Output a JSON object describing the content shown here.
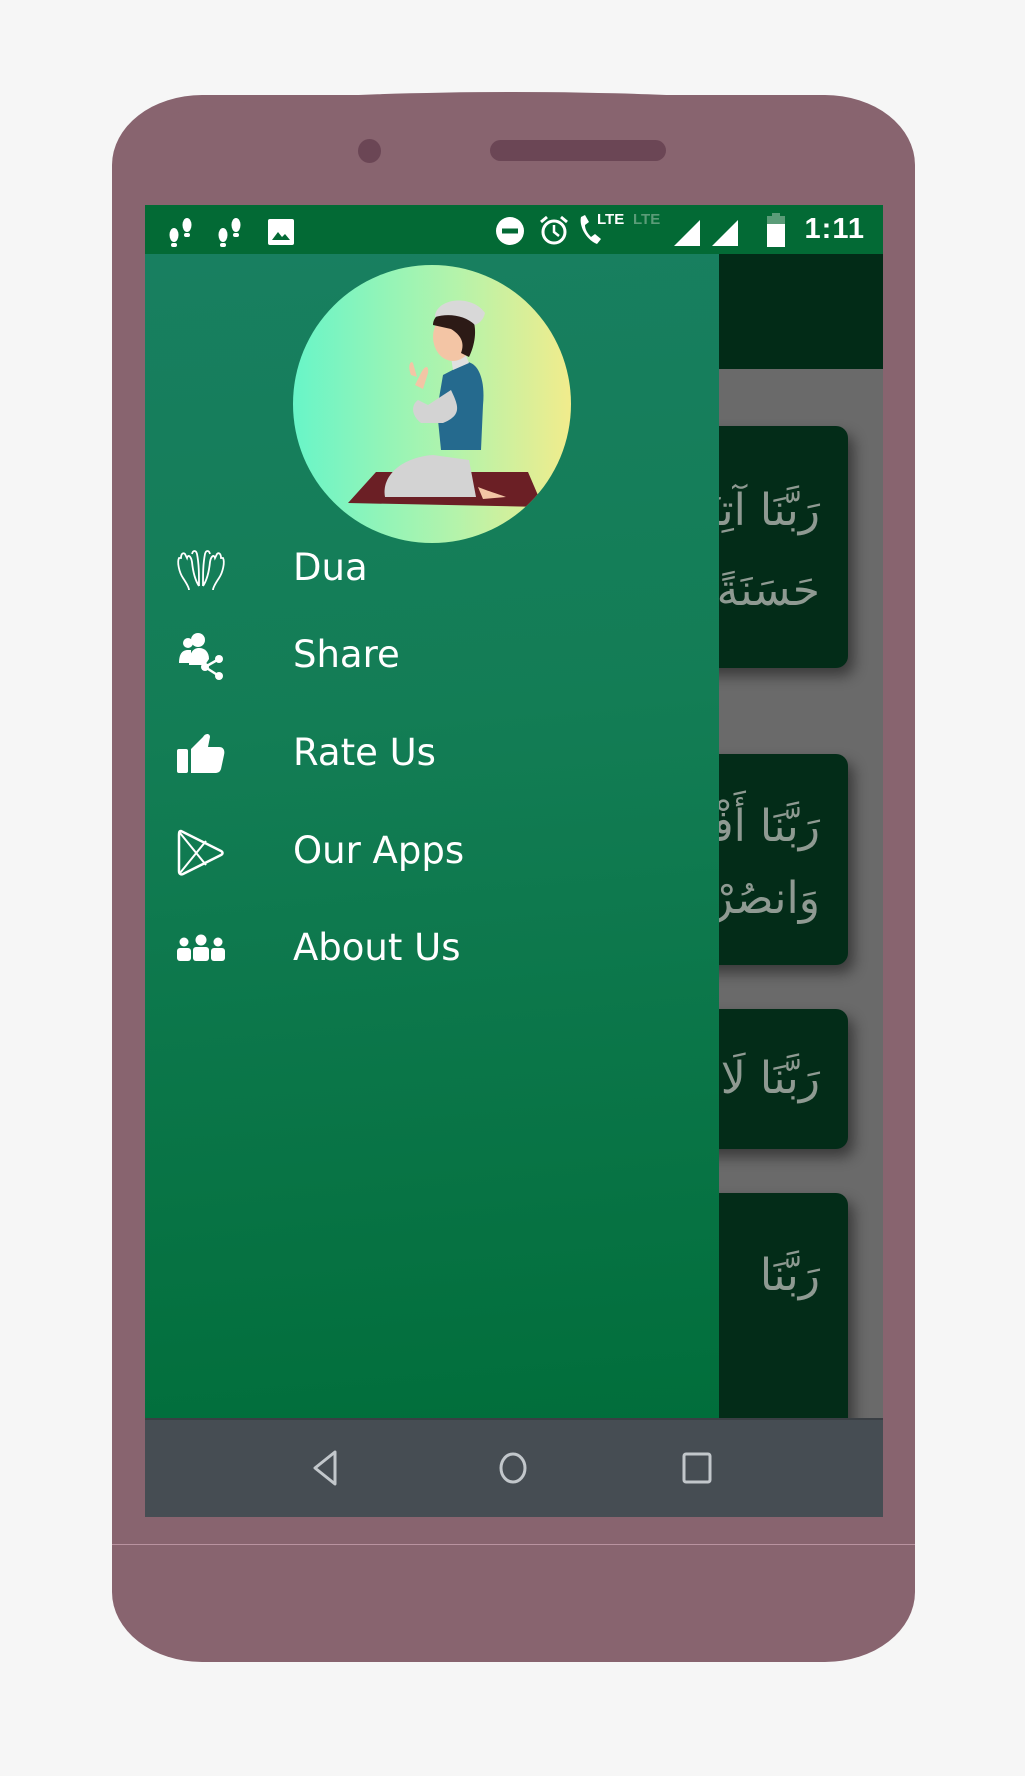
{
  "status_bar": {
    "left_icons": [
      "footsteps-icon",
      "footsteps-icon",
      "image-icon"
    ],
    "right_icons": [
      "do-not-disturb-icon",
      "alarm-icon",
      "lte-call-icon",
      "lte-disabled-icon",
      "signal-icon",
      "signal-icon",
      "battery-icon"
    ],
    "lte_label": "LTE",
    "lte_disabled_label": "LTE",
    "time": "1:11"
  },
  "drawer": {
    "header_image": "boy-praying-on-mat",
    "items": [
      {
        "label": "Dua",
        "icon": "praying-hands-icon"
      },
      {
        "label": "Share",
        "icon": "share-users-icon"
      },
      {
        "label": "Rate Us",
        "icon": "thumbs-up-icon"
      },
      {
        "label": "Our Apps",
        "icon": "play-store-icon"
      },
      {
        "label": "About Us",
        "icon": "group-icon"
      }
    ]
  },
  "background_cards": [
    {
      "lines": [
        "رَبَّنَا آتِنَا",
        "حَسَنَةً"
      ]
    },
    {
      "lines": [
        "رَبَّنَا أَفْرِغْ",
        "وَانصُرْنَا"
      ]
    },
    {
      "lines": [
        "رَبَّنَا لَا"
      ]
    },
    {
      "lines": [
        "رَبَّنَا"
      ]
    }
  ],
  "nav_bar": {
    "back": "back-icon",
    "home": "home-icon",
    "recents": "recents-icon"
  },
  "colors": {
    "status_bar": "#036a35",
    "drawer_top": "#187f60",
    "drawer_bottom": "#016e3b",
    "phone_frame": "#88646f",
    "nav_bar": "#464d53"
  }
}
